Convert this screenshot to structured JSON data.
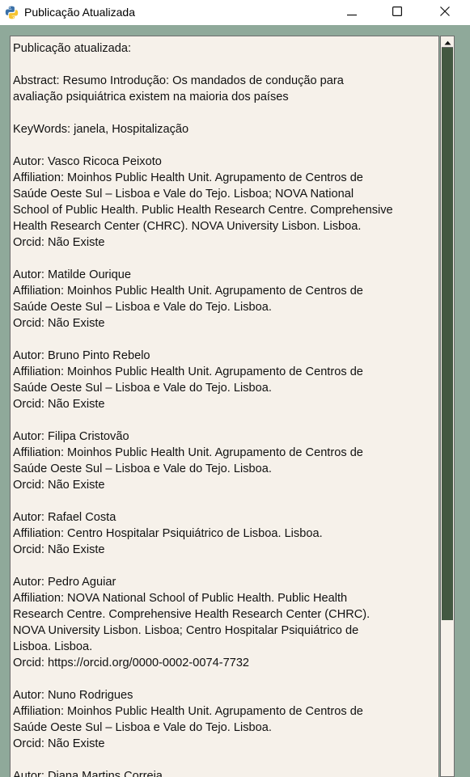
{
  "window": {
    "title": "Publicação Atualizada",
    "icon": "python-icon",
    "controls": {
      "minimize": "minimize-icon",
      "maximize": "maximize-icon",
      "close": "close-icon"
    }
  },
  "content": {
    "lines": [
      "Publicação atualizada:",
      "",
      "Abstract: Resumo Introdução: Os mandados de condução para",
      "avaliação psiquiátrica existem na maioria dos países",
      "",
      "KeyWords: janela, Hospitalização",
      "",
      "Autor: Vasco Ricoca Peixoto",
      "Affiliation: Moinhos Public Health Unit. Agrupamento de Centros de",
      "Saúde Oeste Sul – Lisboa e Vale do Tejo. Lisboa; NOVA National",
      "School of Public Health. Public Health Research Centre. Comprehensive",
      "Health Research Center (CHRC). NOVA University Lisbon. Lisboa.",
      "Orcid: Não Existe",
      "",
      "Autor: Matilde Ourique",
      "Affiliation: Moinhos Public Health Unit. Agrupamento de Centros de",
      "Saúde Oeste Sul – Lisboa e Vale do Tejo. Lisboa.",
      "Orcid: Não Existe",
      "",
      "Autor: Bruno Pinto Rebelo",
      "Affiliation: Moinhos Public Health Unit. Agrupamento de Centros de",
      "Saúde Oeste Sul – Lisboa e Vale do Tejo. Lisboa.",
      "Orcid: Não Existe",
      "",
      "Autor: Filipa Cristovão",
      "Affiliation: Moinhos Public Health Unit. Agrupamento de Centros de",
      "Saúde Oeste Sul – Lisboa e Vale do Tejo. Lisboa.",
      "Orcid: Não Existe",
      "",
      "Autor: Rafael Costa",
      "Affiliation: Centro Hospitalar Psiquiátrico de Lisboa. Lisboa.",
      "Orcid: Não Existe",
      "",
      "Autor: Pedro Aguiar",
      "Affiliation: NOVA National School of Public Health. Public Health",
      "Research Centre. Comprehensive Health Research Center (CHRC).",
      "NOVA University Lisbon. Lisboa; Centro Hospitalar Psiquiátrico de",
      "Lisboa. Lisboa.",
      "Orcid: https://orcid.org/0000-0002-0074-7732",
      "",
      "Autor: Nuno Rodrigues",
      "Affiliation: Moinhos Public Health Unit. Agrupamento de Centros de",
      "Saúde Oeste Sul – Lisboa e Vale do Tejo. Lisboa.",
      "Orcid: Não Existe",
      "",
      "Autor: Diana Martins Correia"
    ]
  },
  "colors": {
    "window_bg": "#8fa99a",
    "text_bg": "#f6f1ea",
    "scroll_thumb": "#435841",
    "titlebar_bg": "#ffffff"
  }
}
